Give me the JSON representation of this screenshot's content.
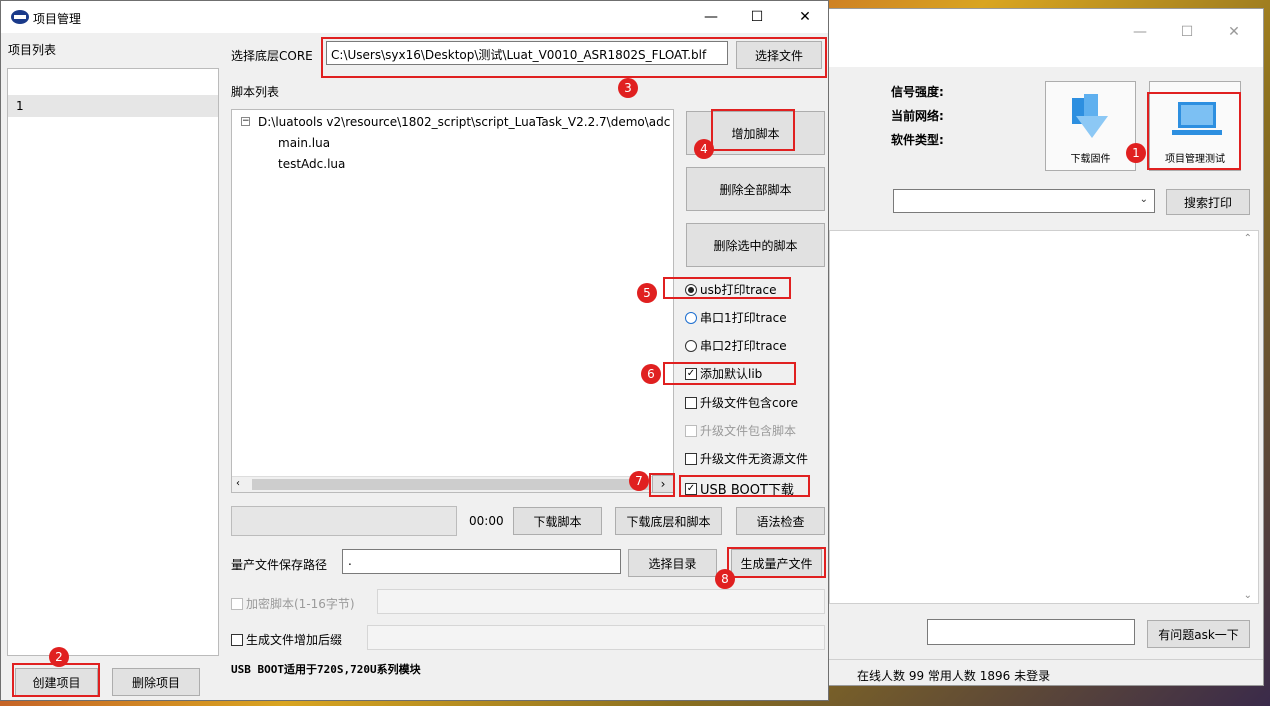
{
  "main_window": {
    "title": "项目管理",
    "controls": {
      "minimize": "—",
      "maximize": "☐",
      "close": "✕"
    }
  },
  "left": {
    "label": "项目列表",
    "items": [
      "1"
    ],
    "create_button": "创建项目",
    "delete_button": "删除项目"
  },
  "core": {
    "label": "选择底层CORE",
    "path": "C:\\Users\\syx16\\Desktop\\测试\\Luat_V0010_ASR1802S_FLOAT.blf",
    "select_button": "选择文件"
  },
  "scripts": {
    "label": "脚本列表",
    "root": "D:\\luatools v2\\resource\\1802_script\\script_LuaTask_V2.2.7\\demo\\adc",
    "files": [
      "main.lua",
      "testAdc.lua"
    ],
    "add_button": "增加脚本",
    "delete_all_button": "删除全部脚本",
    "delete_selected_button": "删除选中的脚本"
  },
  "options": {
    "usb_trace": "usb打印trace",
    "uart1_trace": "串口1打印trace",
    "uart2_trace": "串口2打印trace",
    "add_lib": "添加默认lib",
    "upgrade_core": "升级文件包含core",
    "upgrade_script": "升级文件包含脚本",
    "upgrade_no_res": "升级文件无资源文件",
    "usb_boot": "USB BOOT下载"
  },
  "download": {
    "time": "00:00",
    "download_script": "下载脚本",
    "download_all": "下载底层和脚本",
    "syntax_check": "语法检查"
  },
  "production": {
    "label": "量产文件保存路径",
    "path": ".",
    "select_dir_button": "选择目录",
    "generate_button": "生成量产文件",
    "encrypt_label": "加密脚本(1-16字节)",
    "suffix_label": "生成文件增加后缀"
  },
  "note": "USB BOOT适用于720S,720U系列模块",
  "badges": [
    "1",
    "2",
    "3",
    "4",
    "5",
    "6",
    "7",
    "8"
  ],
  "bg_window": {
    "signal_label": "信号强度:",
    "network_label": "当前网络:",
    "software_label": "软件类型:",
    "download_firmware": "下载固件",
    "project_test": "项目管理测试",
    "search_print": "搜索打印",
    "ask_button": "有问题ask一下",
    "status": "在线人数 99 常用人数 1896 未登录"
  },
  "colors": {
    "highlight": "#e02020",
    "accent": "#1e6fd0"
  }
}
